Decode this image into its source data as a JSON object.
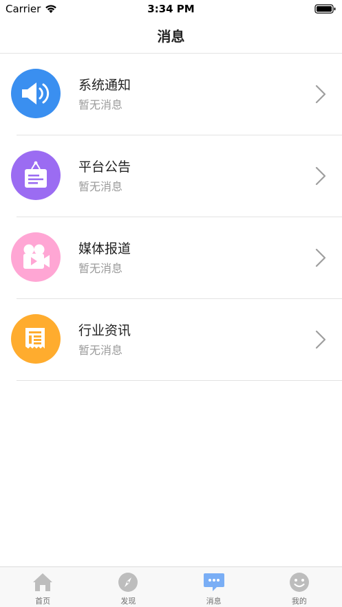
{
  "status_bar": {
    "carrier": "Carrier",
    "time": "3:34 PM"
  },
  "header": {
    "title": "消息"
  },
  "messages": [
    {
      "title": "系统通知",
      "subtitle": "暂无消息",
      "icon": "speaker-icon",
      "color": "#3a8ff0"
    },
    {
      "title": "平台公告",
      "subtitle": "暂无消息",
      "icon": "notice-board-icon",
      "color": "#9b6cf2"
    },
    {
      "title": "媒体报道",
      "subtitle": "暂无消息",
      "icon": "video-camera-icon",
      "color": "#ffa6d4"
    },
    {
      "title": "行业资讯",
      "subtitle": "暂无消息",
      "icon": "newspaper-icon",
      "color": "#ffac2e"
    }
  ],
  "tab_bar": {
    "tabs": [
      {
        "label": "首页",
        "icon": "home-icon"
      },
      {
        "label": "发现",
        "icon": "compass-icon"
      },
      {
        "label": "消息",
        "icon": "chat-bubble-icon",
        "active": true
      },
      {
        "label": "我的",
        "icon": "smiley-face-icon"
      }
    ],
    "active_color": "#7aaef5",
    "inactive_color": "#bdbdbd"
  }
}
